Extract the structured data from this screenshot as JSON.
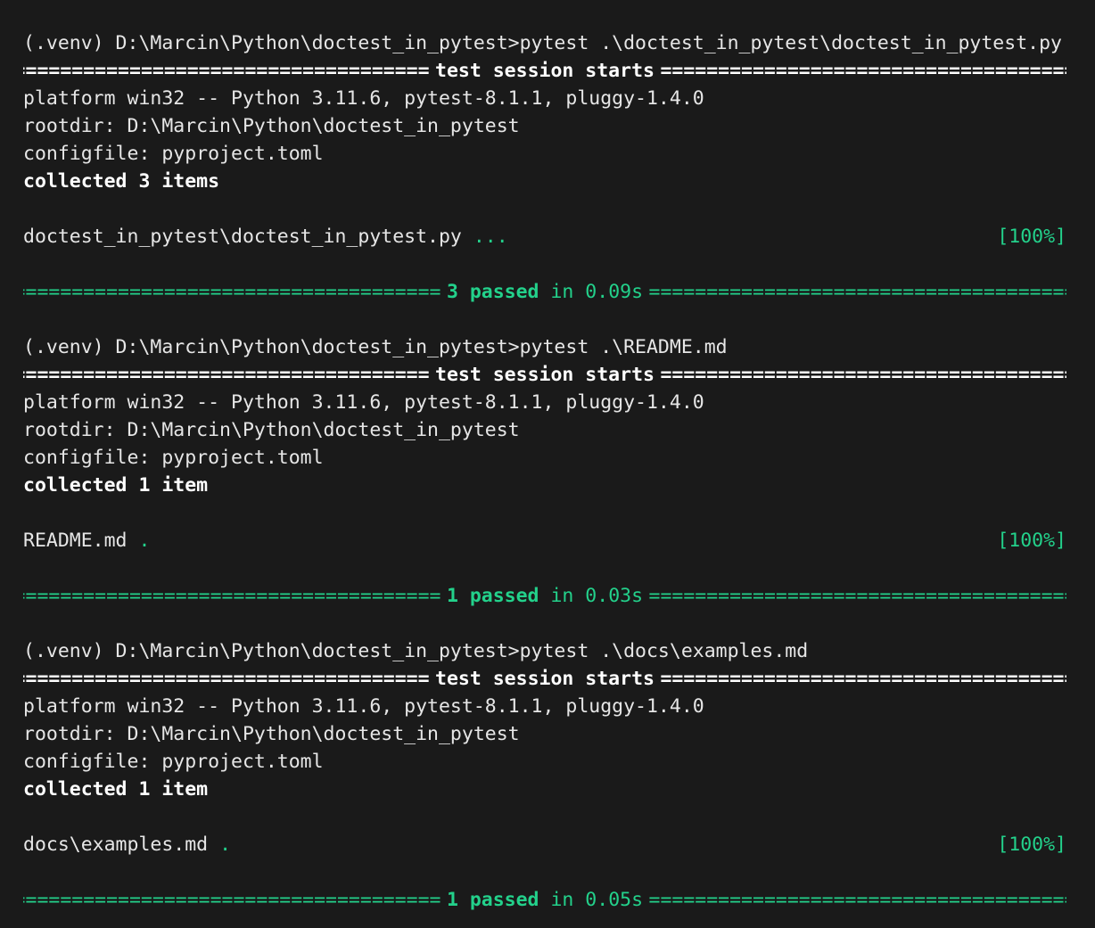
{
  "colors": {
    "background": "#1a1a1a",
    "text": "#e6e6e6",
    "pass": "#23d18b",
    "bold_text": "#ffffff"
  },
  "runs": [
    {
      "command": "(.venv) D:\\Marcin\\Python\\doctest_in_pytest>pytest .\\doctest_in_pytest\\doctest_in_pytest.py",
      "session_header": "test session starts",
      "platform": "platform win32 -- Python 3.11.6, pytest-8.1.1, pluggy-1.4.0",
      "rootdir": "rootdir: D:\\Marcin\\Python\\doctest_in_pytest",
      "configfile": "configfile: pyproject.toml",
      "collected": "collected 3 items",
      "result_file": "doctest_in_pytest\\doctest_in_pytest.py",
      "result_dots": "...",
      "result_percent": "[100%]",
      "summary_count": "3 passed",
      "summary_time": "in 0.09s"
    },
    {
      "command": "(.venv) D:\\Marcin\\Python\\doctest_in_pytest>pytest .\\README.md",
      "session_header": "test session starts",
      "platform": "platform win32 -- Python 3.11.6, pytest-8.1.1, pluggy-1.4.0",
      "rootdir": "rootdir: D:\\Marcin\\Python\\doctest_in_pytest",
      "configfile": "configfile: pyproject.toml",
      "collected": "collected 1 item",
      "result_file": "README.md",
      "result_dots": ".",
      "result_percent": "[100%]",
      "summary_count": "1 passed",
      "summary_time": "in 0.03s"
    },
    {
      "command": "(.venv) D:\\Marcin\\Python\\doctest_in_pytest>pytest .\\docs\\examples.md",
      "session_header": "test session starts",
      "platform": "platform win32 -- Python 3.11.6, pytest-8.1.1, pluggy-1.4.0",
      "rootdir": "rootdir: D:\\Marcin\\Python\\doctest_in_pytest",
      "configfile": "configfile: pyproject.toml",
      "collected": "collected 1 item",
      "result_file": "docs\\examples.md",
      "result_dots": ".",
      "result_percent": "[100%]",
      "summary_count": "1 passed",
      "summary_time": "in 0.05s"
    }
  ]
}
